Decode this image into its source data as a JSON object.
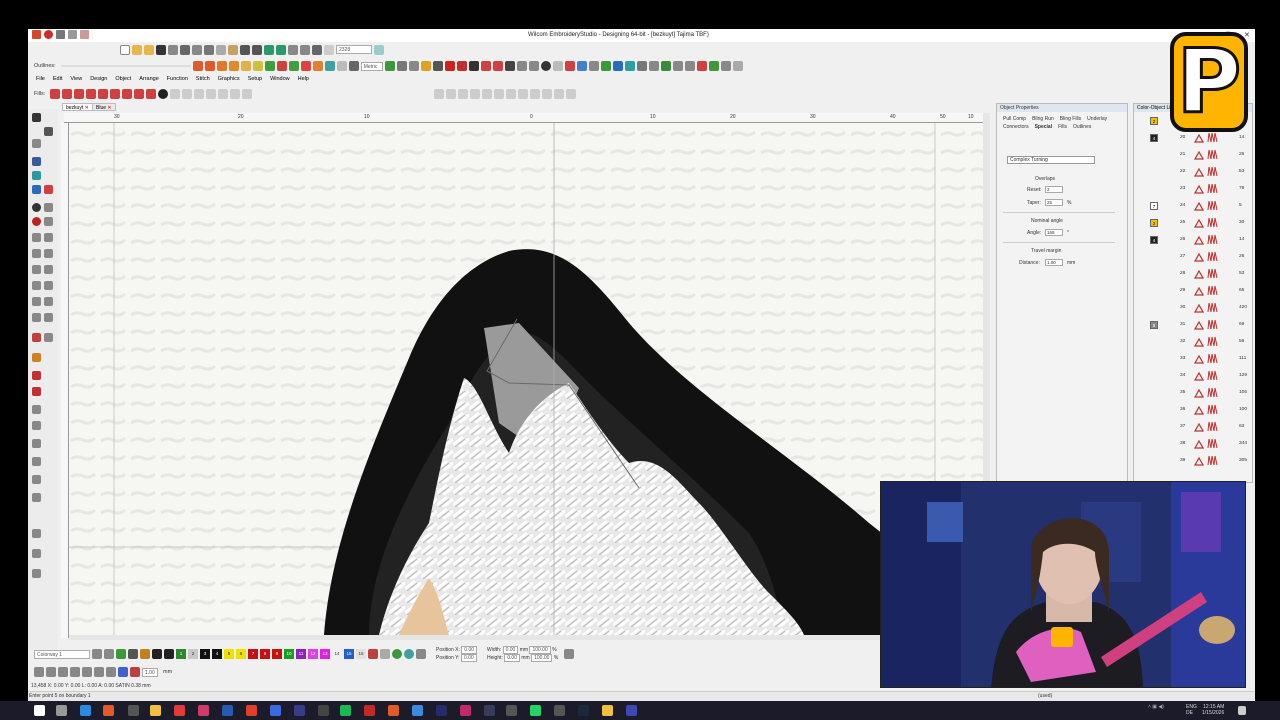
{
  "window": {
    "title": "Wilcom EmbroideryStudio - Designing 64-bit - [bezkuyt]   Tajima TBF)",
    "minimize": "–",
    "maximize": "□",
    "close": "✕"
  },
  "menu": {
    "items": [
      "File",
      "Edit",
      "View",
      "Design",
      "Object",
      "Arrange",
      "Function",
      "Stitch",
      "Graphics",
      "Setup",
      "Window",
      "Help"
    ]
  },
  "toolbar": {
    "outlines_label": "Outlines:",
    "fills_label": "Fills:",
    "zoom_value": "2328",
    "metric_value": "Metric"
  },
  "doc_tabs": [
    {
      "label": "bezkuyt",
      "close": "✕"
    },
    {
      "label": "Blue",
      "close": "✕"
    }
  ],
  "ruler": {
    "top_ticks": [
      "30",
      "20",
      "10",
      "0",
      "10",
      "20",
      "30",
      "40",
      "50",
      "10"
    ]
  },
  "object_properties": {
    "title": "Object Properties",
    "tabs": [
      "Pull Comp",
      "Bling Run",
      "Bling Fills",
      "Underlay",
      "Connectors",
      "Special",
      "Fills",
      "Outlines"
    ],
    "stitch_type": "Complex Turning",
    "overlaps_heading": "Overlaps",
    "reset_label": "Reset:",
    "reset_value": "2",
    "taper_label": "Taper:",
    "taper_value": "25",
    "taper_unit": "%",
    "nominal_angle_heading": "Nominal angle",
    "angle_label": "Angle:",
    "angle_value": "168",
    "angle_unit": "°",
    "travel_margin_heading": "Travel margin",
    "distance_label": "Distance:",
    "distance_value": "1.00",
    "distance_unit": "mm"
  },
  "color_object_list": {
    "title": "Color-Object List",
    "rows": [
      {
        "swatch": "2",
        "swatch_color": "#f6c000",
        "num": "",
        "count": ""
      },
      {
        "swatch": "4",
        "swatch_color": "#222222",
        "num": "20",
        "count": "14"
      },
      {
        "swatch": "",
        "swatch_color": "",
        "num": "21",
        "count": "26"
      },
      {
        "swatch": "",
        "swatch_color": "",
        "num": "22",
        "count": "53"
      },
      {
        "swatch": "",
        "swatch_color": "",
        "num": "23",
        "count": "78"
      },
      {
        "swatch": "7",
        "swatch_color": "#ffffff",
        "num": "24",
        "count": "5"
      },
      {
        "swatch": "2",
        "swatch_color": "#f6c000",
        "num": "25",
        "count": "30"
      },
      {
        "swatch": "4",
        "swatch_color": "#222222",
        "num": "26",
        "count": "14"
      },
      {
        "swatch": "",
        "swatch_color": "",
        "num": "27",
        "count": "26"
      },
      {
        "swatch": "",
        "swatch_color": "",
        "num": "28",
        "count": "53"
      },
      {
        "swatch": "",
        "swatch_color": "",
        "num": "29",
        "count": "65"
      },
      {
        "swatch": "",
        "swatch_color": "",
        "num": "30",
        "count": "420"
      },
      {
        "swatch": "5",
        "swatch_color": "#888888",
        "num": "31",
        "count": "69"
      },
      {
        "swatch": "",
        "swatch_color": "",
        "num": "32",
        "count": "56"
      },
      {
        "swatch": "",
        "swatch_color": "",
        "num": "33",
        "count": "111"
      },
      {
        "swatch": "",
        "swatch_color": "",
        "num": "34",
        "count": "129"
      },
      {
        "swatch": "",
        "swatch_color": "",
        "num": "35",
        "count": "106"
      },
      {
        "swatch": "",
        "swatch_color": "",
        "num": "36",
        "count": "100"
      },
      {
        "swatch": "",
        "swatch_color": "",
        "num": "37",
        "count": "63"
      },
      {
        "swatch": "",
        "swatch_color": "",
        "num": "38",
        "count": "344"
      },
      {
        "swatch": "",
        "swatch_color": "",
        "num": "39",
        "count": "305"
      }
    ]
  },
  "bottom_toolbar": {
    "colorway_value": "Colorway 1",
    "stitch_value": "1.00",
    "stitch_unit": "mm",
    "swatches": [
      {
        "label": "1",
        "color": "#2a8a2a"
      },
      {
        "label": "2",
        "color": "#c8c8c8"
      },
      {
        "label": "3",
        "color": "#111111"
      },
      {
        "label": "4",
        "color": "#111111"
      },
      {
        "label": "5",
        "color": "#f0e000"
      },
      {
        "label": "6",
        "color": "#f0e000"
      },
      {
        "label": "7",
        "color": "#c81010"
      },
      {
        "label": "8",
        "color": "#c81010"
      },
      {
        "label": "9",
        "color": "#c81010"
      },
      {
        "label": "10",
        "color": "#1e9e1e"
      },
      {
        "label": "11",
        "color": "#9020c0"
      },
      {
        "label": "12",
        "color": "#e040e0"
      },
      {
        "label": "13",
        "color": "#e020e0"
      },
      {
        "label": "14",
        "color": "#f0f0f0"
      },
      {
        "label": "15",
        "color": "#2060d0"
      },
      {
        "label": "16",
        "color": "#e0e0e0"
      }
    ],
    "position_x_label": "Position X:",
    "position_y_label": "Position Y:",
    "position_x": "0.00",
    "position_y": "0.00",
    "width_label": "Width:",
    "height_label": "Height:",
    "width": "0.00",
    "height": "0.00",
    "scale_w": "100.00",
    "scale_h": "100.00",
    "unit_mm": "mm",
    "unit_pct": "%"
  },
  "status": {
    "line1": "13,458     X: 0.00   Y: 0.00    L: 0.00   A: 0.00              SATIN  0.38 mm",
    "line2": "Enter point 5 on boundary 1",
    "used": "(used)"
  },
  "taskbar": {
    "lang1": "ENG",
    "lang2": "DE",
    "time": "12:15 AM",
    "date": "1/15/2026"
  },
  "overlay_logo": {
    "letter": "P",
    "color": "#ffb400"
  }
}
